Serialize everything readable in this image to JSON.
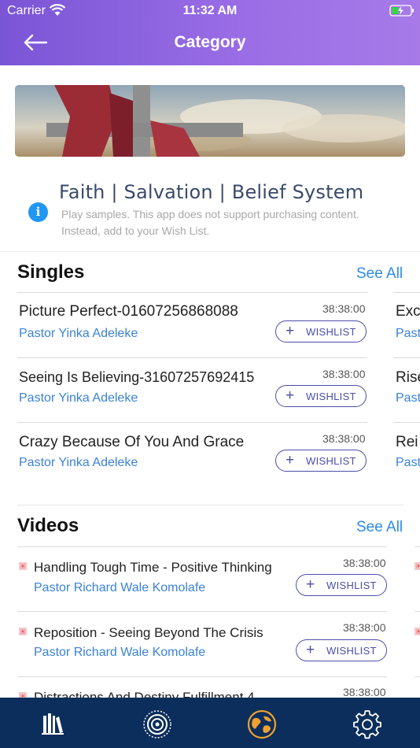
{
  "status_bar": {
    "carrier": "Carrier",
    "time": "11:32 AM"
  },
  "header": {
    "title": "Category"
  },
  "category": {
    "name": "Faith | Salvation | Belief System",
    "notice_line1": "Play samples. This app does not support purchasing content.",
    "notice_line2": "Instead, add to your Wish List."
  },
  "singles": {
    "title": "Singles",
    "see_all": "See All",
    "items": [
      {
        "title": "Picture Perfect-01607256868088",
        "author": "Pastor Yinka Adeleke",
        "duration": "38:38:00",
        "button": "WISHLIST"
      },
      {
        "title": "Seeing Is Believing-31607257692415",
        "author": "Pastor Yinka Adeleke",
        "duration": "38:38:00",
        "button": "WISHLIST"
      },
      {
        "title": "Crazy Because Of You And Grace",
        "author": "Pastor Yinka Adeleke",
        "duration": "38:38:00",
        "button": "WISHLIST"
      }
    ],
    "peek": [
      {
        "title": "Exc",
        "author": "Past"
      },
      {
        "title": "Rise",
        "author": "Past"
      },
      {
        "title": "Rei",
        "author": "Past"
      }
    ]
  },
  "videos": {
    "title": "Videos",
    "see_all": "See All",
    "items": [
      {
        "title": "Handling Tough Time - Positive Thinking",
        "author": "Pastor Richard Wale Komolafe",
        "duration": "38:38:00",
        "button": "WISHLIST"
      },
      {
        "title": "Reposition - Seeing Beyond The Crisis",
        "author": "Pastor Richard Wale Komolafe",
        "duration": "38:38:00",
        "button": "WISHLIST"
      },
      {
        "title": "Distractions And Destiny Fulfillment 4",
        "author": "",
        "duration": "38:38:00",
        "button": ""
      }
    ]
  },
  "tab_bar": {
    "tabs": [
      {
        "icon": "library-icon",
        "active": false
      },
      {
        "icon": "radio-icon",
        "active": false
      },
      {
        "icon": "globe-icon",
        "active": true
      },
      {
        "icon": "settings-icon",
        "active": false
      }
    ],
    "active_color": "#f0a030",
    "inactive_color": "#ffffff"
  },
  "colors": {
    "header_start": "#7a55d6",
    "header_end": "#a77ae8",
    "link": "#2d8ae6",
    "tab_bar": "#0c2e5c"
  }
}
